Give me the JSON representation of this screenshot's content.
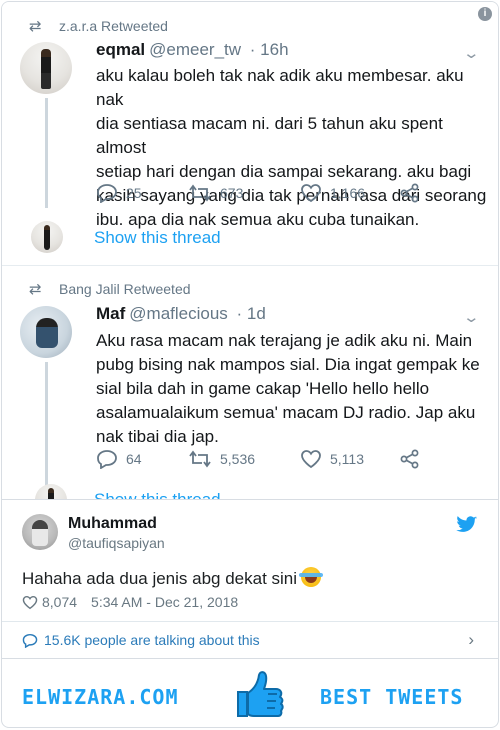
{
  "tweet1": {
    "retweeted_by": "z.a.r.a Retweeted",
    "name": "eqmal",
    "handle": "@emeer_tw",
    "time": "· 16h",
    "lines": [
      "aku kalau boleh tak nak adik aku membesar. aku nak",
      "dia sentiasa macam ni. dari 5 tahun aku spent almost",
      "setiap hari dengan dia sampai sekarang. aku bagi",
      "kasih sayang yang dia tak pernah rasa dari seorang",
      "ibu. apa dia nak semua aku cuba tunaikan."
    ],
    "replies": "25",
    "retweets": "673",
    "likes": "1,166",
    "show_thread": "Show this thread"
  },
  "tweet2": {
    "retweeted_by": "Bang Jalil Retweeted",
    "name": "Maf",
    "handle": "@maflecious",
    "time": "· 1d",
    "lines": [
      "Aku rasa macam nak terajang je adik aku ni. Main",
      "pubg bising nak mampos sial. Dia ingat gempak ke",
      "sial bila dah in game cakap 'Hello hello hello",
      "asalamualaikum semua' macam DJ radio. Jap aku",
      "nak tibai dia jap."
    ],
    "replies": "64",
    "retweets": "5,536",
    "likes": "5,113",
    "show_thread": "Show this thread"
  },
  "embed": {
    "name": "Muhammad",
    "handle": "@taufiqsapiyan",
    "text": "Hahaha ada dua jenis abg dekat sini",
    "likes": "8,074",
    "timestamp": "5:34 AM - Dec 21, 2018",
    "talking": "15.6K people are talking about this"
  },
  "footer": {
    "left": "ELWIZARA.COM",
    "right": "BEST TWEETS"
  },
  "colors": {
    "accent": "#1da1f2",
    "muted": "#657786",
    "text": "#14171a"
  }
}
